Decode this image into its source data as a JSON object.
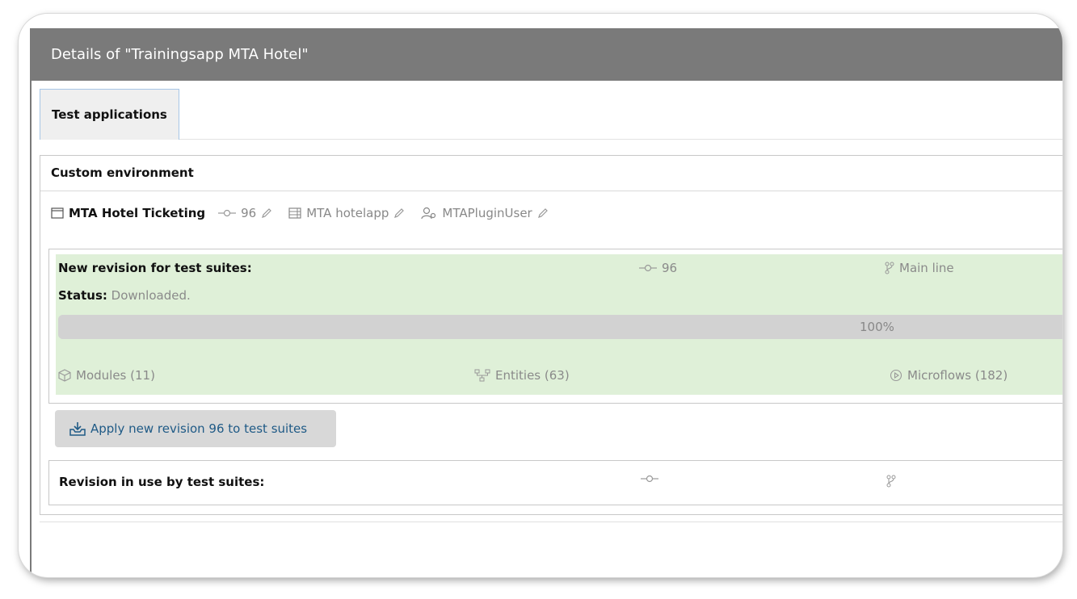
{
  "header": {
    "title": "Details of \"Trainingsapp MTA Hotel\""
  },
  "tabs": [
    {
      "label": "Test applications"
    }
  ],
  "environment": {
    "title": "Custom environment",
    "app": {
      "name": "MTA Hotel Ticketing",
      "revision": "96",
      "server": "MTA hotelapp",
      "user": "MTAPluginUser"
    }
  },
  "new_revision": {
    "label": "New revision for test suites:",
    "revision": "96",
    "branch": "Main line",
    "status_label": "Status:",
    "status_value": "Downloaded.",
    "progress_percent": 100,
    "progress_text": "100%",
    "modules": "Modules (11)",
    "entities": "Entities (63)",
    "microflows": "Microflows (182)"
  },
  "apply_button": {
    "label": "Apply new revision 96 to test suites"
  },
  "revision_in_use": {
    "label": "Revision in use by test suites:",
    "revision": "",
    "branch": ""
  },
  "colors": {
    "header_bg": "#7a7a7a",
    "success_bg": "#dff0d8",
    "link": "#1f5a86",
    "muted": "#8a8a8a"
  }
}
